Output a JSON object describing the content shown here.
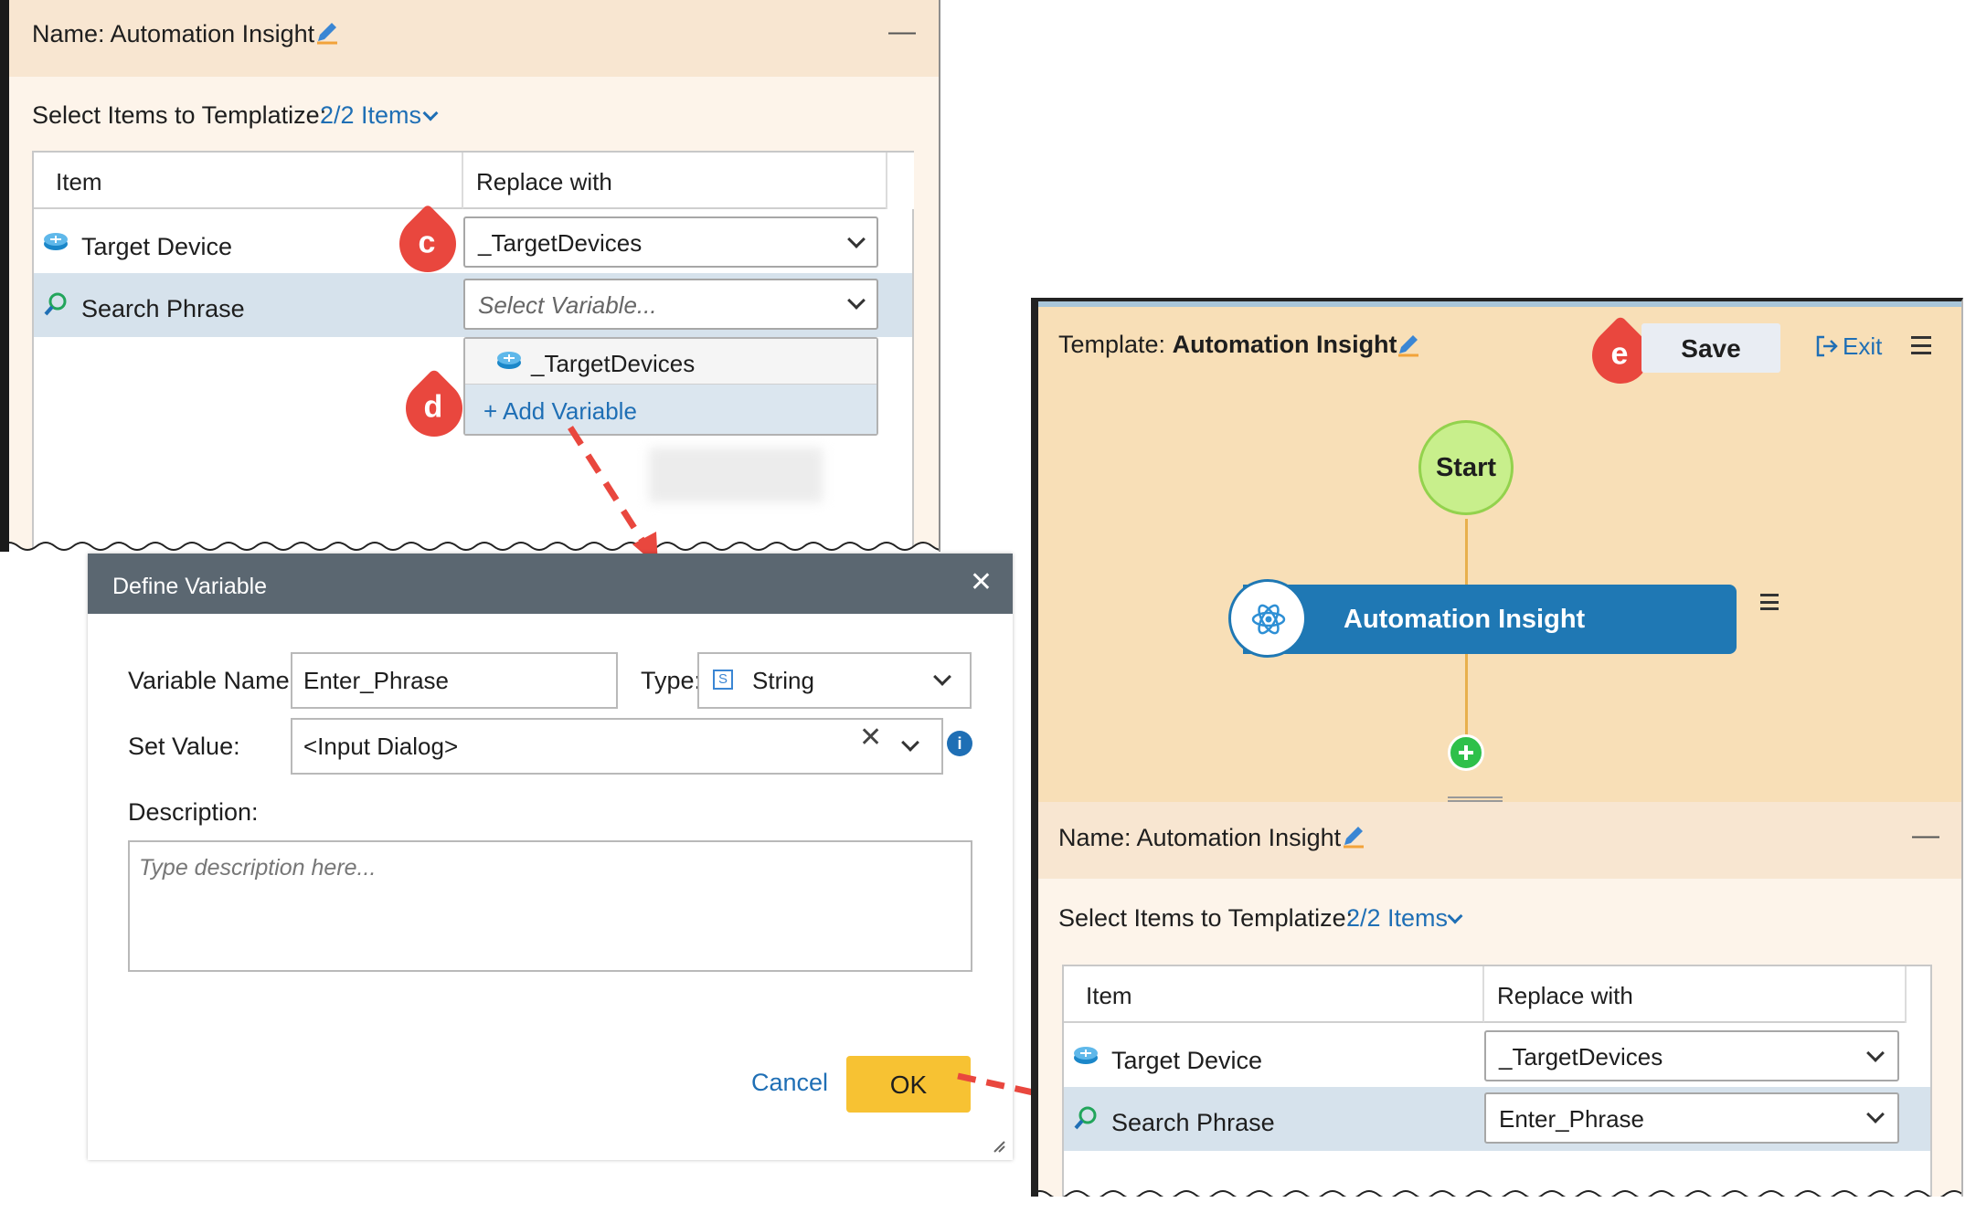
{
  "panel_a": {
    "name_label": "Name: Automation Insight",
    "collapse_symbol": "—",
    "select_label": "Select Items to Templatize:",
    "select_count": "2/2 Items",
    "columns": [
      "Item",
      "Replace with"
    ],
    "rows": [
      {
        "item": "Target Device",
        "icon": "router-icon",
        "replace": "_TargetDevices"
      },
      {
        "item": "Search Phrase",
        "icon": "search-phrase-icon",
        "replace_placeholder": "Select Variable..."
      }
    ],
    "dropdown_options": [
      {
        "label": "_TargetDevices",
        "icon": "router-icon"
      },
      {
        "label": "+ Add Variable"
      }
    ],
    "callouts": [
      "c",
      "d"
    ]
  },
  "dialog": {
    "title": "Define Variable",
    "close_symbol": "✕",
    "variable_name_label": "Variable Name:",
    "variable_name_value": "Enter_Phrase",
    "type_label": "Type:",
    "type_badge": "S",
    "type_value": "String",
    "set_value_label": "Set Value:",
    "set_value_value": "<Input Dialog>",
    "clear_symbol": "✕",
    "info_symbol": "i",
    "description_label": "Description:",
    "description_placeholder": "Type description here...",
    "cancel_label": "Cancel",
    "ok_label": "OK"
  },
  "panel_b": {
    "template_label": "Template:",
    "template_name": "Automation Insight",
    "callout": "e",
    "save_label": "Save",
    "exit_label": "Exit",
    "flow": {
      "start_label": "Start",
      "node_label": "Automation Insight"
    },
    "name_label": "Name: Automation Insight",
    "collapse_symbol": "—",
    "select_label": "Select Items to Templatize:",
    "select_count": "2/2 Items",
    "columns": [
      "Item",
      "Replace with"
    ],
    "rows": [
      {
        "item": "Target Device",
        "icon": "router-icon",
        "replace": "_TargetDevices"
      },
      {
        "item": "Search Phrase",
        "icon": "search-phrase-icon",
        "replace": "Enter_Phrase"
      }
    ]
  },
  "colors": {
    "callout": "#e9473e",
    "arrow": "#e9473e",
    "link": "#1f6fb5",
    "dialog_header": "#5b6771",
    "ok_button": "#f7c233",
    "start_node": "#c8ef8c",
    "flow_node": "#1f78b4",
    "canvas": "#f8dfb7",
    "row_highlight": "#d6e2ec"
  }
}
